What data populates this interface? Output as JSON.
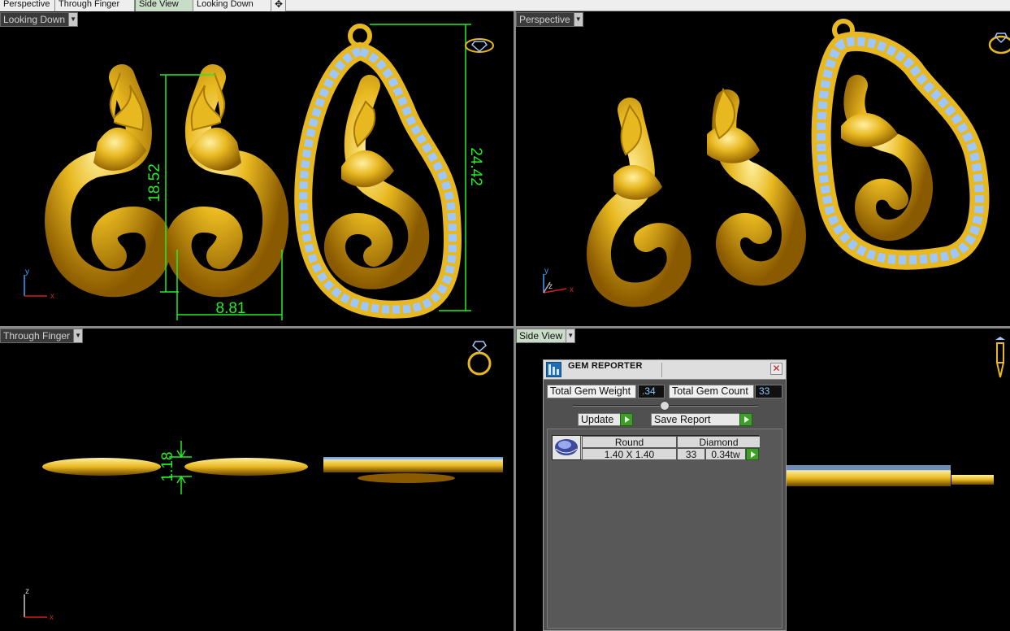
{
  "tabs": [
    {
      "label": "Perspective",
      "active": false
    },
    {
      "label": "Through Finger",
      "active": false
    },
    {
      "label": "Side View",
      "active": true
    },
    {
      "label": "Looking Down",
      "active": false
    }
  ],
  "add_tab_symbol": "✥",
  "viewports": {
    "top_left": {
      "label": "Looking Down",
      "dimensions": [
        "18.52",
        "8.81",
        "24.42"
      ],
      "axis_x": "x",
      "axis_y": "y"
    },
    "top_right": {
      "label": "Perspective",
      "axis_x": "x",
      "axis_y": "y",
      "axis_z": "z"
    },
    "bottom_left": {
      "label": "Through Finger",
      "dimension": "1.18",
      "axis_x": "x",
      "axis_z": "z"
    },
    "bottom_right": {
      "label": "Side View"
    }
  },
  "gem_reporter": {
    "title": "GEM REPORTER",
    "close_symbol": "✕",
    "total_weight_label": "Total Gem Weight",
    "total_weight_value": ".34",
    "total_count_label": "Total Gem Count",
    "total_count_value": "33",
    "update_label": "Update",
    "save_report_label": "Save Report",
    "rows": [
      {
        "shape": "Round",
        "size": "1.40 X 1.40",
        "type": "Diamond",
        "count": "33",
        "weight": "0.34tw"
      }
    ]
  },
  "colors": {
    "gold": "#e8b820",
    "gem": "#9ec6ff",
    "dimension": "#22ee22",
    "active_tab": "#c8dcc8"
  }
}
